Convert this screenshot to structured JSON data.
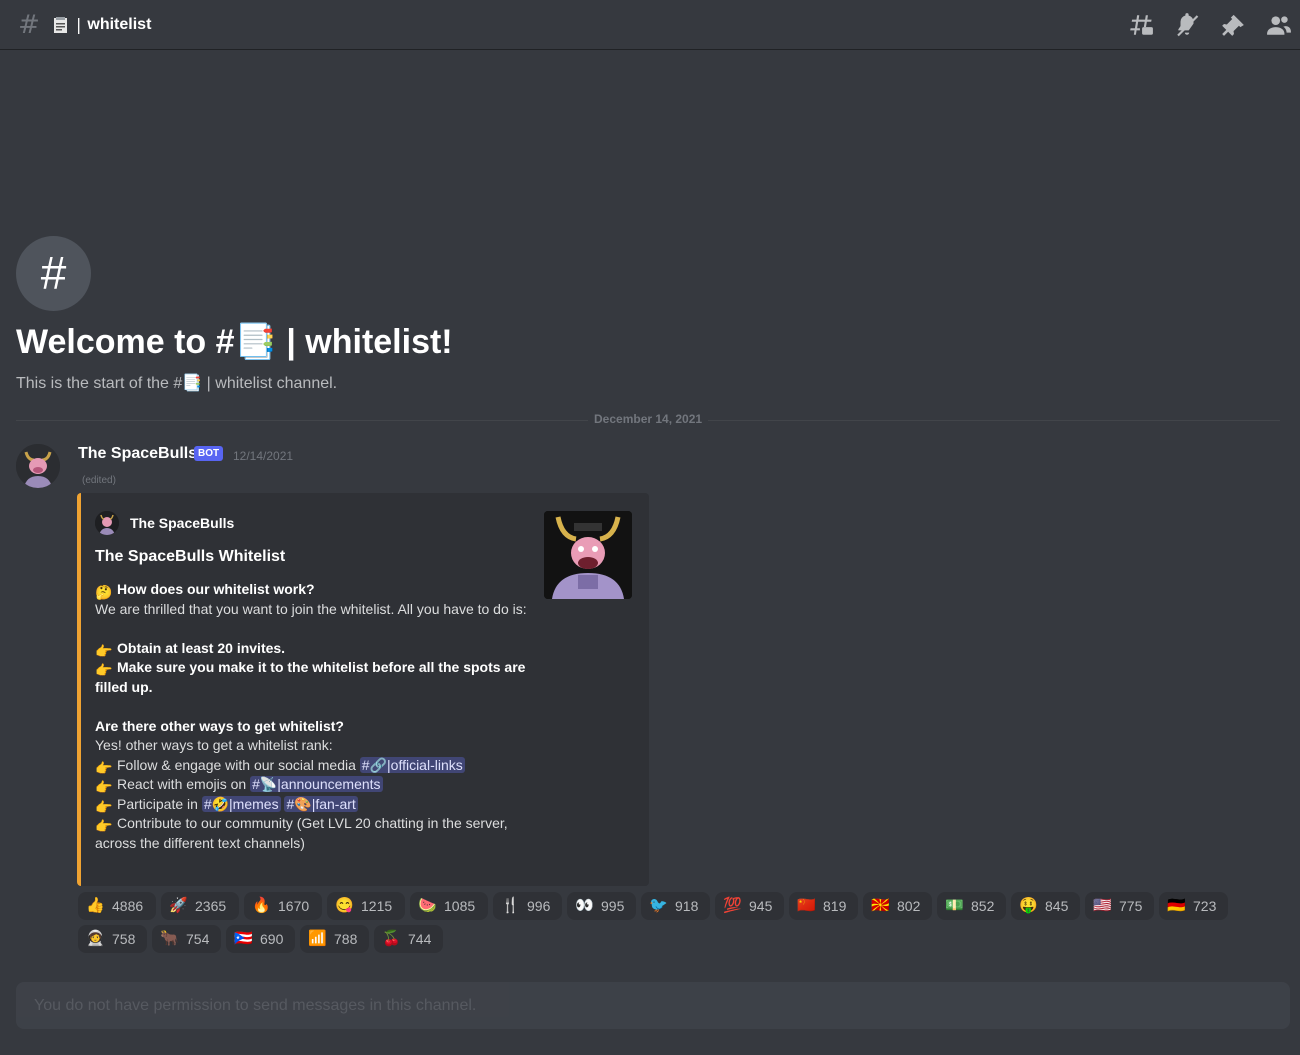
{
  "header": {
    "channel_name": "whitelist",
    "icons": [
      "threads-icon",
      "notifications-muted-icon",
      "pin-icon",
      "member-list-icon"
    ]
  },
  "welcome": {
    "title": "Welcome to #📑 | whitelist!",
    "subtitle": "This is the start of the #📑 | whitelist channel."
  },
  "divider": {
    "date": "December 14, 2021"
  },
  "message": {
    "author": "The SpaceBulls",
    "badge": "BOT",
    "timestamp": "12/14/2021",
    "edited": "(edited)"
  },
  "embed": {
    "accent_color": "#f0a332",
    "author": "The SpaceBulls",
    "title": "The SpaceBulls Whitelist",
    "q1": "How does our whitelist work?",
    "p1": "We are thrilled that you want to join the whitelist. All you have to do is:",
    "s1": "Obtain at least 20 invites.",
    "s2": "Make sure you make it to the whitelist before all the spots are filled up.",
    "q2": "Are there other ways to get whitelist?",
    "p2": "Yes! other ways to get a whitelist rank:",
    "w1": "Follow & engage with our social media",
    "w1_channel": "#🔗|official-links",
    "w2": "React with emojis on",
    "w2_channel": "#📡|announcements",
    "w3": "Participate in",
    "w3_channel_a": "#🤣|memes",
    "w3_channel_b": "#🎨|fan-art",
    "w4": "Contribute to our community (Get LVL 20 chatting in the server, across the different text channels)"
  },
  "reactions": [
    {
      "emoji": "👍",
      "count": "4886"
    },
    {
      "emoji": "🚀",
      "count": "2365"
    },
    {
      "emoji": "🔥",
      "count": "1670"
    },
    {
      "emoji": "😋",
      "count": "1215"
    },
    {
      "emoji": "🍉",
      "count": "1085"
    },
    {
      "emoji": "🍴",
      "count": "996"
    },
    {
      "emoji": "👀",
      "count": "995"
    },
    {
      "emoji": "🐦",
      "count": "918"
    },
    {
      "emoji": "💯",
      "count": "945"
    },
    {
      "emoji": "🇨🇳",
      "count": "819"
    },
    {
      "emoji": "🇲🇰",
      "count": "802"
    },
    {
      "emoji": "💵",
      "count": "852"
    },
    {
      "emoji": "🤑",
      "count": "845"
    },
    {
      "emoji": "🇺🇸",
      "count": "775"
    },
    {
      "emoji": "🇩🇪",
      "count": "723"
    },
    {
      "emoji": "🧑‍🚀",
      "count": "758"
    },
    {
      "emoji": "🐂",
      "count": "754"
    },
    {
      "emoji": "🇵🇷",
      "count": "690"
    },
    {
      "emoji": "📶",
      "count": "788"
    },
    {
      "emoji": "🍒",
      "count": "744"
    }
  ],
  "composer": {
    "placeholder": "You do not have permission to send messages in this channel."
  }
}
